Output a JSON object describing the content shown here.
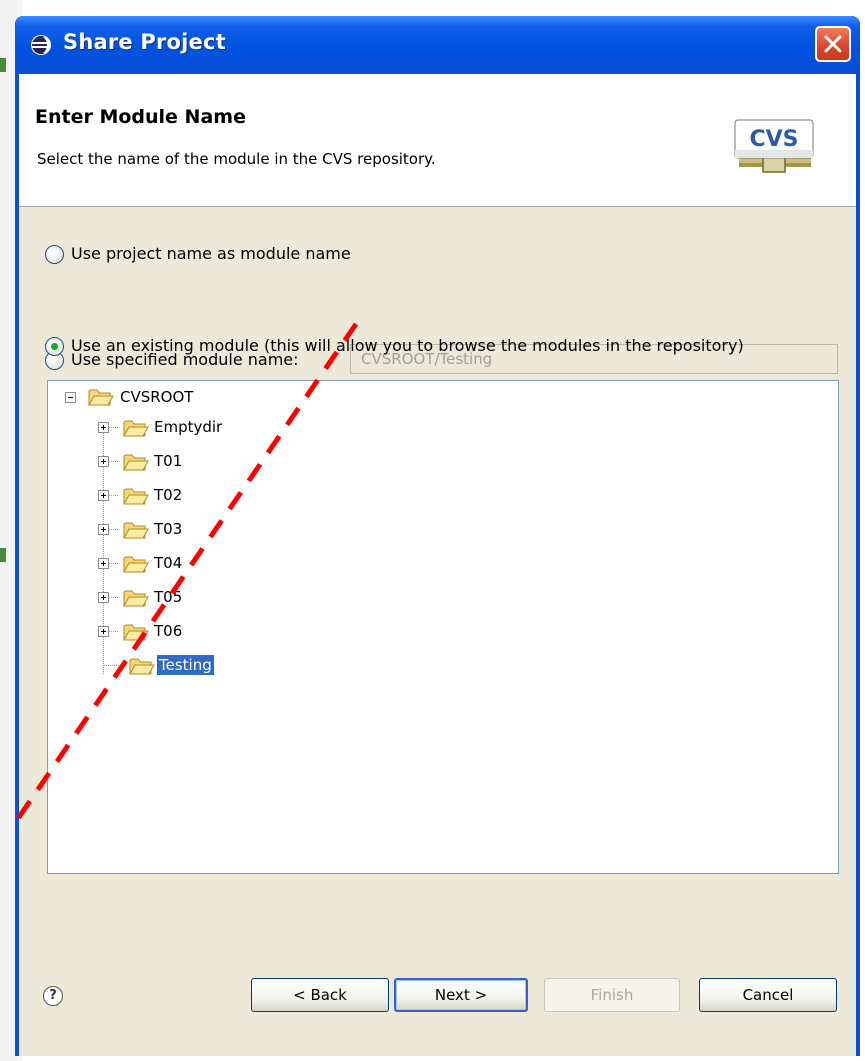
{
  "window": {
    "title": "Share Project",
    "icon": "eclipse-icon",
    "close_icon": "close-icon"
  },
  "header": {
    "title": "Enter Module Name",
    "description": "Select the name of the module in the CVS repository.",
    "logo_text": "CVS"
  },
  "options": [
    {
      "label": "Use project name as module name",
      "checked": false
    },
    {
      "label": "Use specified module name:",
      "checked": false
    },
    {
      "label": "Use an existing module (this will allow you to browse the modules in the repository)",
      "checked": true
    }
  ],
  "module_name_field": {
    "value": "CVSROOT/Testing",
    "enabled": false
  },
  "tree": {
    "root": {
      "label": "CVSROOT",
      "expanded": true
    },
    "children": [
      {
        "label": "Emptydir",
        "expandable": true,
        "selected": false
      },
      {
        "label": "T01",
        "expandable": true,
        "selected": false
      },
      {
        "label": "T02",
        "expandable": true,
        "selected": false
      },
      {
        "label": "T03",
        "expandable": true,
        "selected": false
      },
      {
        "label": "T04",
        "expandable": true,
        "selected": false
      },
      {
        "label": "T05",
        "expandable": true,
        "selected": false
      },
      {
        "label": "T06",
        "expandable": true,
        "selected": false
      },
      {
        "label": "Testing",
        "expandable": false,
        "selected": true
      }
    ]
  },
  "footer": {
    "help_symbol": "?",
    "buttons": {
      "back": "< Back",
      "next": "Next >",
      "finish": "Finish",
      "cancel": "Cancel"
    }
  },
  "colors": {
    "titlebar": "#0054e3",
    "selection": "#316ac5",
    "annotation": "#ff0000"
  }
}
